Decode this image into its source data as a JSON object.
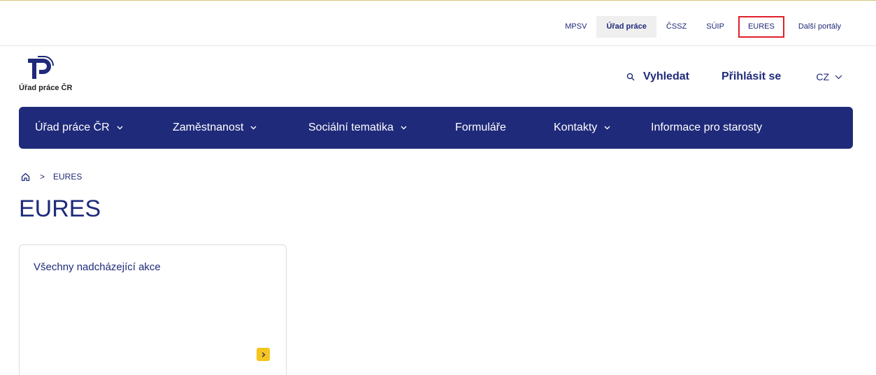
{
  "portal_links": [
    "MPSV",
    "Úřad práce",
    "ČSSZ",
    "SÚIP",
    "EURES",
    "Další portály"
  ],
  "logo": {
    "text": "Úřad práce ČR"
  },
  "header": {
    "search_label": "Vyhledat",
    "login_label": "Přihlásit se",
    "language": "CZ"
  },
  "nav": {
    "items": [
      {
        "label": "Úřad práce ČR",
        "has_dropdown": true
      },
      {
        "label": "Zaměstnanost",
        "has_dropdown": true
      },
      {
        "label": "Sociální tematika",
        "has_dropdown": true
      },
      {
        "label": "Formuláře",
        "has_dropdown": false
      },
      {
        "label": "Kontakty",
        "has_dropdown": true
      },
      {
        "label": "Informace pro starosty",
        "has_dropdown": false
      }
    ]
  },
  "breadcrumb": {
    "current": "EURES"
  },
  "page": {
    "title": "EURES"
  },
  "card": {
    "title": "Všechny nadcházející akce"
  },
  "colors": {
    "primary": "#1f2a7a",
    "accent": "#f4c51e",
    "highlight_outline": "#e0202a"
  }
}
